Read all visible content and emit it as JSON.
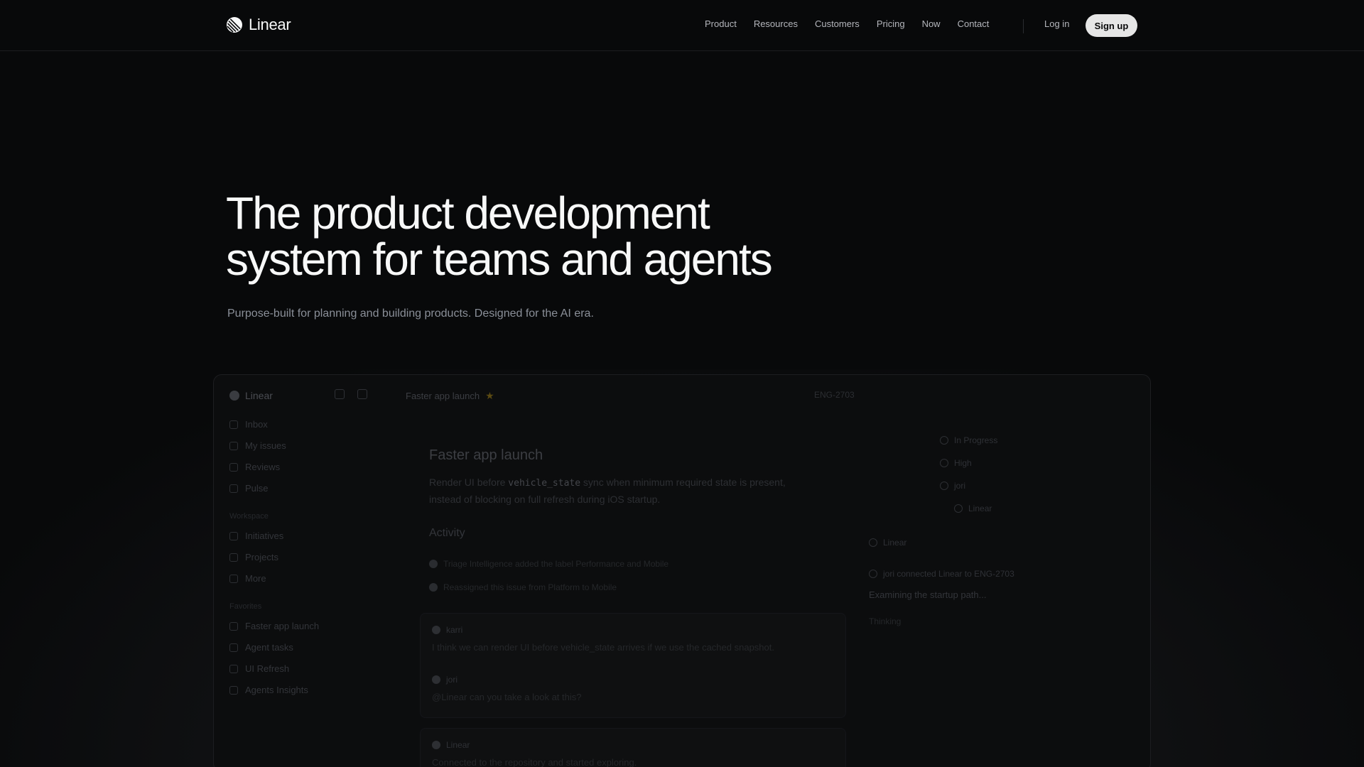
{
  "header": {
    "brand": "Linear",
    "nav": [
      "Product",
      "Resources",
      "Customers",
      "Pricing",
      "Now",
      "Contact"
    ],
    "login": "Log in",
    "signup": "Sign up"
  },
  "hero": {
    "title": "The product development\nsystem for teams and agents",
    "subtitle": "Purpose-built for planning and building products. Designed for the AI era."
  },
  "preview": {
    "sidebar": {
      "workspace": "Linear",
      "items": [
        "Inbox",
        "My issues",
        "Reviews",
        "Pulse"
      ],
      "group_workspace": "Workspace",
      "workspace_items": [
        "Initiatives",
        "Projects",
        "More"
      ],
      "group_favorites": "Favorites",
      "favorites": [
        "Faster app launch",
        "Agent tasks",
        "UI Refresh",
        "Agents Insights"
      ]
    },
    "tab_title": "Faster app launch",
    "issue": {
      "title": "Faster app launch",
      "desc_before": "Render UI before ",
      "desc_code": "vehicle_state",
      "desc_after": " sync when minimum required state is present, instead of blocking on full refresh during iOS startup.",
      "id": "ENG-2703"
    },
    "activity": {
      "heading": "Activity",
      "lines": [
        "Triage Intelligence added the label Performance and Mobile",
        "Reassigned this issue from Platform to Mobile"
      ]
    },
    "comments": [
      {
        "author": "karri",
        "text": "I think we can render UI before vehicle_state arrives if we use the cached snapshot."
      },
      {
        "author": "jori",
        "text": "@Linear can you take a look at this?"
      },
      {
        "author": "Linear",
        "text": "Connected to the repository and started exploring."
      }
    ],
    "properties": {
      "status": "In Progress",
      "priority": "High",
      "assignee": "jori",
      "delegate": "Linear"
    },
    "agent": {
      "name": "Linear",
      "line": "jori connected Linear to ENG-2703",
      "status": "Examining the startup path...",
      "thinking": "Thinking"
    }
  }
}
